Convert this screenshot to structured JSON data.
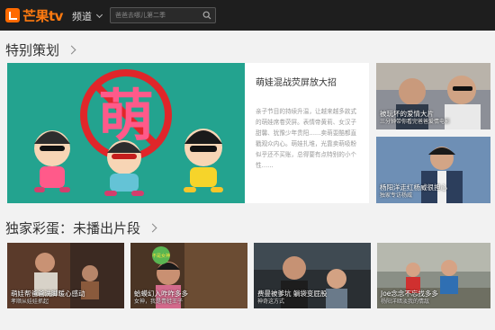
{
  "header": {
    "logo_text": "芒果tv",
    "channel_label": "频道",
    "search_placeholder": "爸爸去哪儿第二季"
  },
  "sections": {
    "special": "特别策划",
    "exclusive": "独家彩蛋：未播出片段"
  },
  "feature": {
    "title": "萌娃混战荧屏放大招",
    "description": "亲子节目的持续升温，让越来越多款式的萌娃席卷荧屏。表情帝黄莉、女汉子甜馨、犹豫少年贵阳……卖萌耍酷都直戳观众内心。萌娃扎堆，光靠卖萌吸粉似乎还不买账，总得要有点特别的小个性……",
    "overlay_char": "萌"
  },
  "side_cards": [
    {
      "caption": "被玩坏的爱情大片",
      "sub": "三分钟带你看完爸爸爱情电影"
    },
    {
      "caption": "杨阳洋走红杨威很担心",
      "sub": "独家专访杨威"
    }
  ],
  "clips": [
    {
      "caption": "萌娃帮爸爸洗脚暖心感动",
      "sub": "孝顺从娃娃抓起"
    },
    {
      "caption": "蛤蟆幻入咋咋多多",
      "sub": "女神，我是青蛙王子",
      "bubble": "不是女神"
    },
    {
      "caption": "费曼被爹坑 躺袋变屁股",
      "sub": "神奇这方式"
    },
    {
      "caption": "Joe念念不忘找多多",
      "sub": "杨阳洋暗淡我的情敌"
    }
  ],
  "colors": {
    "brand": "#ff6a00",
    "topbar": "#1e1e1e",
    "feature_bg": "#23a38f",
    "no_sign": "#e0262a",
    "meng_pink": "#ff5a8a"
  },
  "icons": {
    "search": "search-icon",
    "logo": "mango-logo-icon",
    "more": "chevron-right-icon"
  }
}
